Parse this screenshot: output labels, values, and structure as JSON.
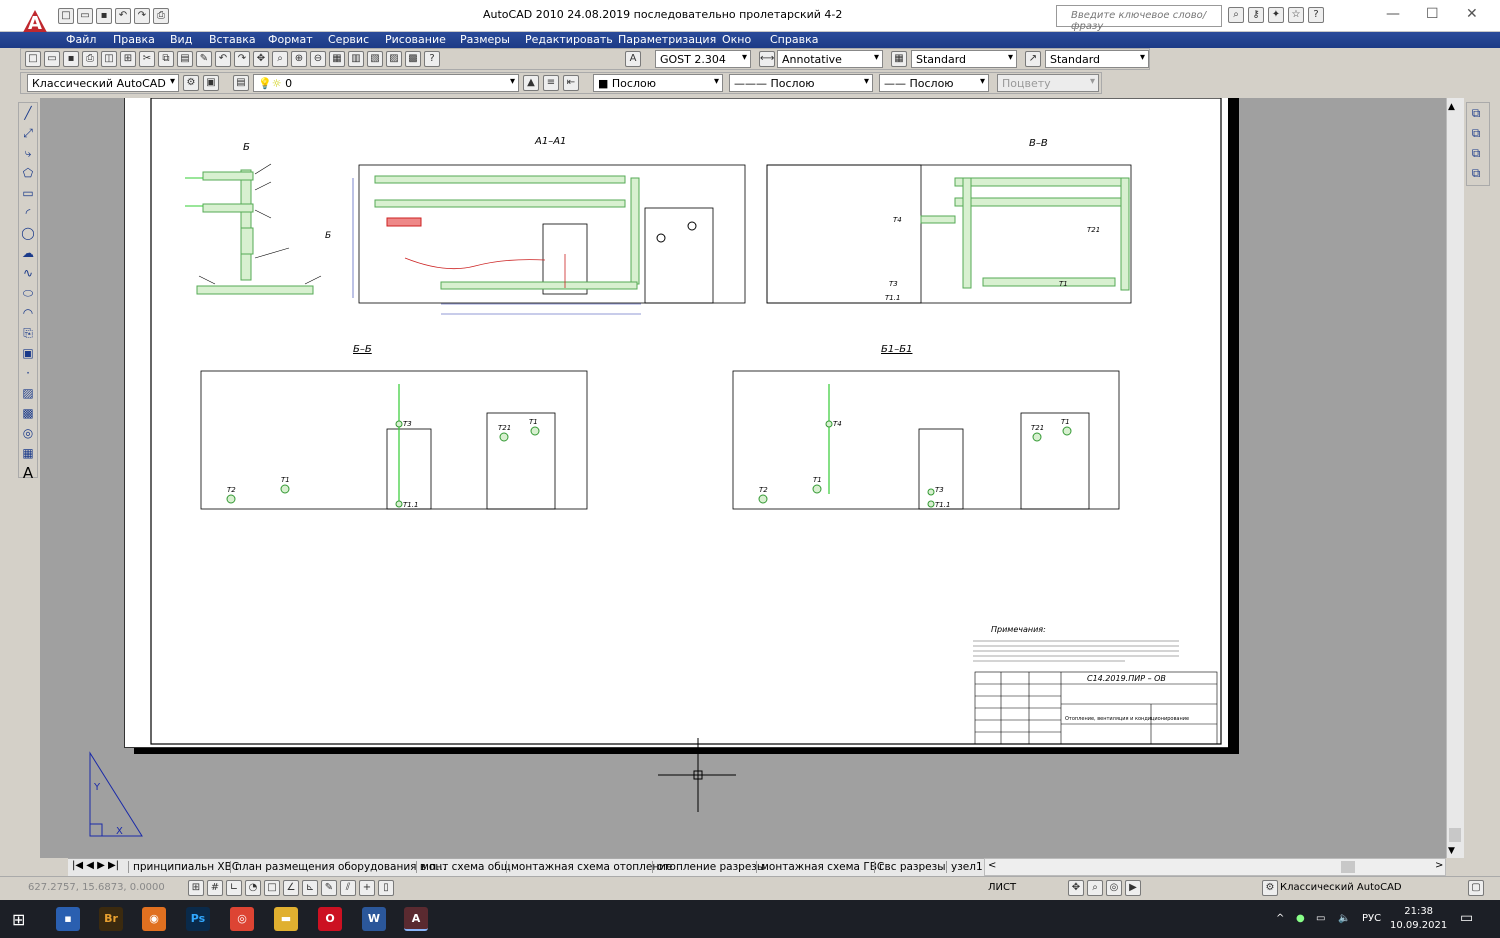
{
  "app": {
    "title_text": "AutoCAD 2010      24.08.2019  последовательно пролетарский 4-2",
    "search_placeholder": "Введите ключевое слово/фразу"
  },
  "menu": [
    "Файл",
    "Правка",
    "Вид",
    "Вставка",
    "Формат",
    "Сервис",
    "Рисование",
    "Размеры",
    "Редактировать",
    "Параметризация",
    "Окно",
    "Справка"
  ],
  "toolbar": {
    "text_style": "GOST 2.304",
    "dim_style": "Annotative",
    "table_style": "Standard",
    "mleader_style": "Standard",
    "workspace": "Классический AutoCAD",
    "layer": "0",
    "color": "Послою",
    "linetype": "Послою",
    "lineweight": "Послою",
    "plotstyle": "Поцвету"
  },
  "drawing": {
    "view_b": "Б",
    "view_a1": "А1–А1",
    "view_v": "В–В",
    "view_bb": "Б–Б",
    "view_b1": "Б1–Б1",
    "label_t2": "Т2",
    "label_t1": "Т1",
    "label_t3": "Т3",
    "label_t11": "Т1.1",
    "label_t21": "Т21",
    "label_t4": "Т4",
    "notes_title": "Примечания:",
    "stamp_code": "С14.2019.ПИР – ОВ",
    "stamp_name": "Отопление, вентиляция и кондиционирование"
  },
  "layout_tabs": [
    "принципиальн ХВС",
    "план размещения оборудования в п...",
    "монт схема общ",
    "монтажная схема отопление",
    "отопление разрезы",
    "монтажная схема ГВС",
    "гвс разрезы",
    "узел1"
  ],
  "status": {
    "coords": "627.2757, 15.6873, 0.0000",
    "space": "ЛИСТ",
    "workspace": "Классический AutoCAD"
  },
  "taskbar": {
    "apps": [
      "save-app",
      "bridge-app",
      "chrome-like",
      "photoshop-app",
      "chrome-app",
      "explorer-app",
      "opera-app",
      "word-app",
      "autocad-app"
    ],
    "lang": "РУС",
    "time": "21:38",
    "date": "10.09.2021"
  }
}
